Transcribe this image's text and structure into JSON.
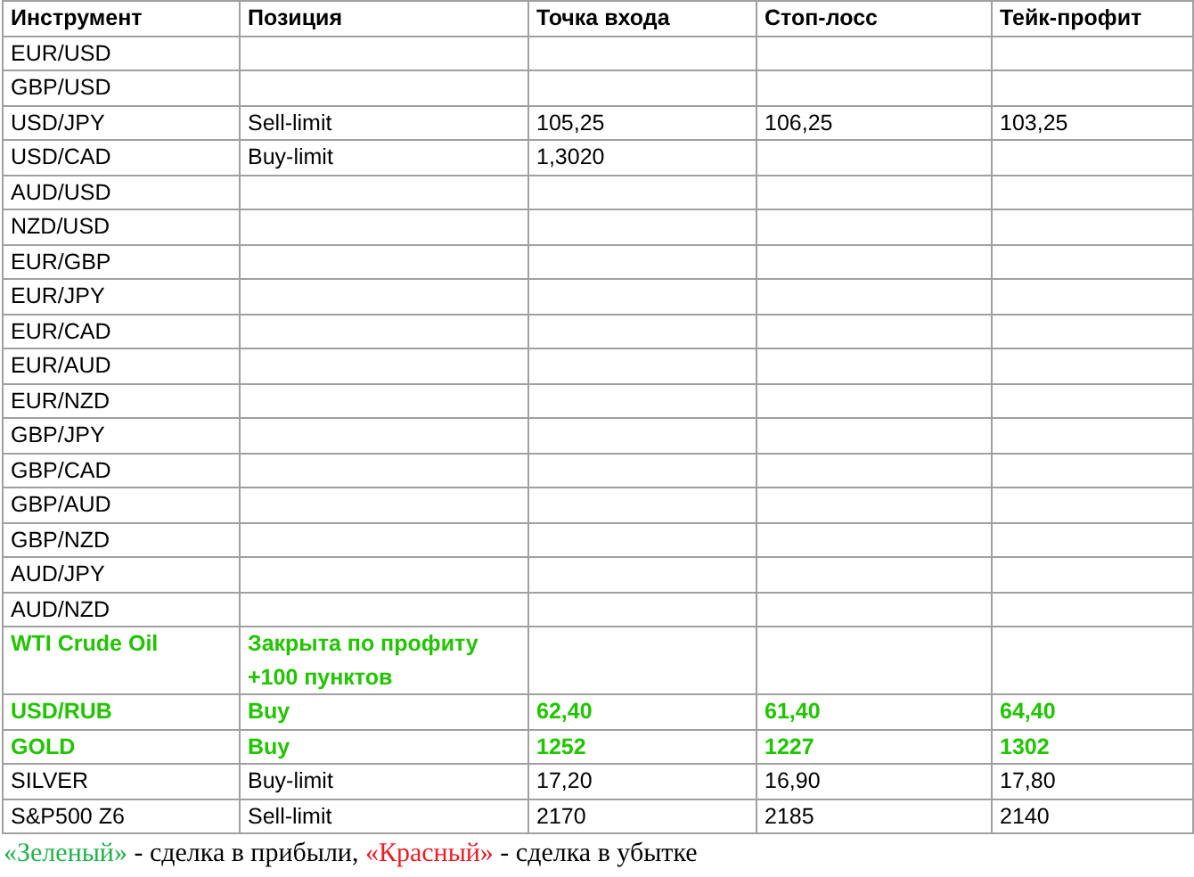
{
  "table": {
    "columns": [
      "Инструмент",
      "Позиция",
      "Точка входа",
      "Стоп-лосс",
      "Тейк-профит"
    ],
    "rows": [
      {
        "profit": false,
        "cells": [
          "EUR/USD",
          null,
          null,
          null,
          null
        ]
      },
      {
        "profit": false,
        "cells": [
          "GBP/USD",
          null,
          null,
          null,
          null
        ]
      },
      {
        "profit": false,
        "cells": [
          "USD/JPY",
          "Sell-limit",
          "105,25",
          "106,25",
          "103,25"
        ]
      },
      {
        "profit": false,
        "cells": [
          "USD/CAD",
          "Buy-limit",
          "1,3020",
          null,
          null
        ]
      },
      {
        "profit": false,
        "cells": [
          "AUD/USD",
          null,
          null,
          null,
          null
        ]
      },
      {
        "profit": false,
        "cells": [
          "NZD/USD",
          null,
          null,
          null,
          null
        ]
      },
      {
        "profit": false,
        "cells": [
          "EUR/GBP",
          null,
          null,
          null,
          null
        ]
      },
      {
        "profit": false,
        "cells": [
          "EUR/JPY",
          null,
          null,
          null,
          null
        ]
      },
      {
        "profit": false,
        "cells": [
          "EUR/CAD",
          null,
          null,
          null,
          null
        ]
      },
      {
        "profit": false,
        "cells": [
          "EUR/AUD",
          null,
          null,
          null,
          null
        ]
      },
      {
        "profit": false,
        "cells": [
          "EUR/NZD",
          null,
          null,
          null,
          null
        ]
      },
      {
        "profit": false,
        "cells": [
          "GBP/JPY",
          null,
          null,
          null,
          null
        ]
      },
      {
        "profit": false,
        "cells": [
          "GBP/CAD",
          null,
          null,
          null,
          null
        ]
      },
      {
        "profit": false,
        "cells": [
          "GBP/AUD",
          null,
          null,
          null,
          null
        ]
      },
      {
        "profit": false,
        "cells": [
          "GBP/NZD",
          null,
          null,
          null,
          null
        ]
      },
      {
        "profit": false,
        "cells": [
          "AUD/JPY",
          null,
          null,
          null,
          null
        ]
      },
      {
        "profit": false,
        "cells": [
          "AUD/NZD",
          null,
          null,
          null,
          null
        ]
      },
      {
        "profit": true,
        "cells": [
          "WTI Crude Oil",
          "Закрыта по профиту\n+100 пунктов",
          null,
          null,
          null
        ]
      },
      {
        "profit": true,
        "cells": [
          "USD/RUB",
          "Buy",
          "62,40",
          "61,40",
          "64,40"
        ]
      },
      {
        "profit": true,
        "cells": [
          "GOLD",
          "Buy",
          "1252",
          "1227",
          "1302"
        ]
      },
      {
        "profit": false,
        "cells": [
          "SILVER",
          "Buy-limit",
          "17,20",
          "16,90",
          "17,80"
        ]
      },
      {
        "profit": false,
        "cells": [
          "S&P500 Z6",
          "Sell-limit",
          "2170",
          "2185",
          "2140"
        ]
      }
    ]
  },
  "legend": [
    {
      "text": "«Зеленый»",
      "color": "#22b24c"
    },
    {
      "text": " - сделка в прибыли, "
    },
    {
      "text": "«Красный»",
      "color": "#ed1c24"
    },
    {
      "text": " - сделка в убытке"
    }
  ]
}
